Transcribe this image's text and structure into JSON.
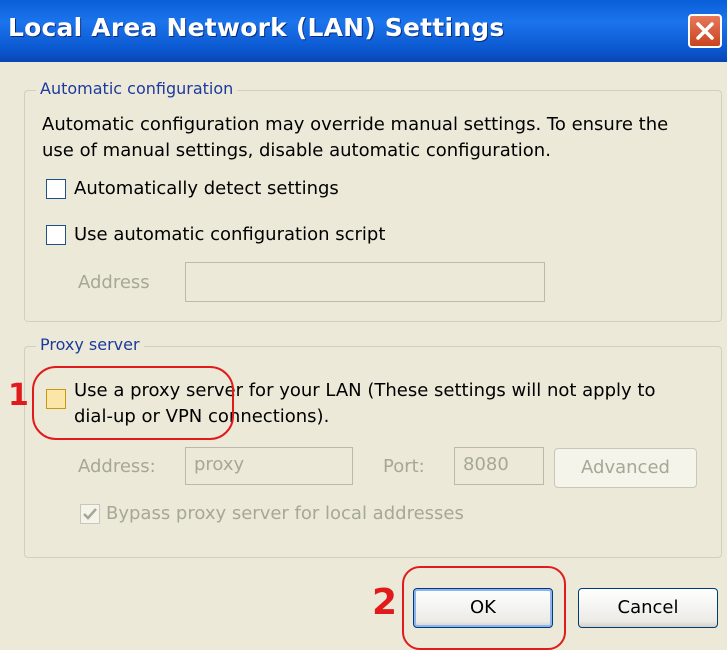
{
  "window": {
    "title": "Local Area Network (LAN) Settings",
    "close_icon": "close-icon"
  },
  "auto_config": {
    "group_title": "Automatic configuration",
    "description_line1": "Automatic configuration may override manual settings.  To ensure the",
    "description_line2": "use of manual settings, disable automatic configuration.",
    "detect_label": "Automatically detect settings",
    "detect_checked": false,
    "script_label": "Use automatic configuration script",
    "script_checked": false,
    "address_label": "Address",
    "address_value": ""
  },
  "proxy": {
    "group_title": "Proxy server",
    "use_proxy_line1": "Use a proxy server for your LAN (These settings will not apply to",
    "use_proxy_line2": "dial-up or VPN connections).",
    "use_proxy_checked": false,
    "address_label": "Address:",
    "address_value": "proxy",
    "port_label": "Port:",
    "port_value": "8080",
    "advanced_label": "Advanced",
    "bypass_label": "Bypass proxy server for local addresses",
    "bypass_checked": true
  },
  "buttons": {
    "ok_label": "OK",
    "cancel_label": "Cancel"
  },
  "annotations": {
    "step1": "1",
    "step2": "2",
    "color": "#e11b1b"
  },
  "colors": {
    "titlebar": "#0a5fd8",
    "dialog_bg": "#ece9d8",
    "group_title": "#1c3a9c"
  }
}
